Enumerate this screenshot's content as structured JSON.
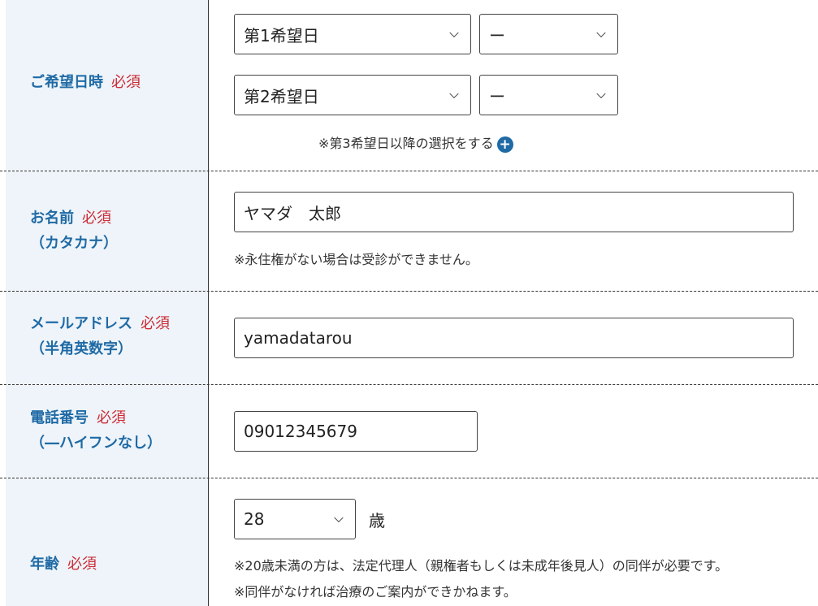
{
  "schedule": {
    "label": "ご希望日時",
    "required": "必須",
    "date1": "第1希望日",
    "time1": "ー",
    "date2": "第2希望日",
    "time2": "ー",
    "add_more": "※第3希望日以降の選択をする",
    "add_icon": "+"
  },
  "name": {
    "label": "お名前",
    "required": "必須",
    "sublabel": "（カタカナ）",
    "value": "ヤマダ　太郎",
    "note": "※永住権がない場合は受診ができません。"
  },
  "email": {
    "label": "メールアドレス",
    "required": "必須",
    "sublabel": "（半角英数字）",
    "value": "yamadatarou"
  },
  "phone": {
    "label": "電話番号",
    "required": "必須",
    "sublabel": "（―ハイフンなし）",
    "value": "09012345679"
  },
  "age": {
    "label": "年齢",
    "required": "必須",
    "value": "28",
    "unit": "歳",
    "note1": "※20歳未満の方は、法定代理人（親権者もしくは未成年後見人）の同伴が必要です。",
    "note2": "※同伴がなければ治療のご案内ができかねます。"
  }
}
